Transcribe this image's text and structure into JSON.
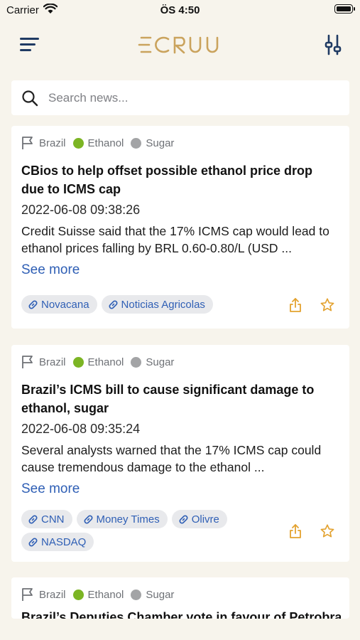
{
  "status_bar": {
    "carrier": "Carrier",
    "time": "ÖS 4:50"
  },
  "header": {
    "logo_text": "ECRUU"
  },
  "search": {
    "placeholder": "Search news..."
  },
  "colors": {
    "accent_gold": "#caa35d",
    "link_blue": "#2f5fb5",
    "tag_green": "#7cb524",
    "tag_gray": "#a3a4a6",
    "nav_blue": "#1f3a63"
  },
  "articles": [
    {
      "region": "Brazil",
      "tag1": "Ethanol",
      "tag2": "Sugar",
      "title": "CBios to help offset possible ethanol price drop due to ICMS cap",
      "date": "2022-06-08 09:38:26",
      "summary": "Credit Suisse said that the 17% ICMS cap would lead to ethanol prices falling by BRL 0.60-0.80/L (USD ...",
      "see_more": "See more",
      "sources": [
        "Novacana",
        "Noticias Agricolas"
      ]
    },
    {
      "region": "Brazil",
      "tag1": "Ethanol",
      "tag2": "Sugar",
      "title": "Brazil’s ICMS bill to cause significant damage to ethanol, sugar",
      "date": "2022-06-08 09:35:24",
      "summary": "Several analysts warned that the 17% ICMS cap could cause tremendous damage to the ethanol ...",
      "see_more": "See more",
      "sources": [
        "CNN",
        "Money Times",
        "Olivre",
        "NASDAQ"
      ]
    },
    {
      "region": "Brazil",
      "tag1": "Ethanol",
      "tag2": "Sugar",
      "title": "Brazil’s Deputies Chamber vote in favour of Petrobras"
    }
  ]
}
